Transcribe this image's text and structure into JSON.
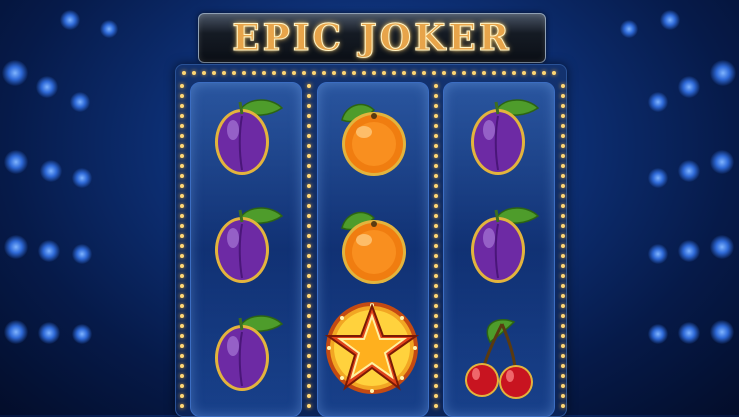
{
  "game": {
    "title": "EPIC JOKER"
  },
  "reels": [
    {
      "symbols": [
        "plum",
        "plum",
        "plum"
      ]
    },
    {
      "symbols": [
        "orange",
        "orange",
        "star"
      ]
    },
    {
      "symbols": [
        "plum",
        "plum",
        "cherry"
      ]
    }
  ],
  "colors": {
    "background": "#0d2f74",
    "frame": "#13326f",
    "bulbs": "#ffd774",
    "title_gold": "#e7a44a"
  }
}
